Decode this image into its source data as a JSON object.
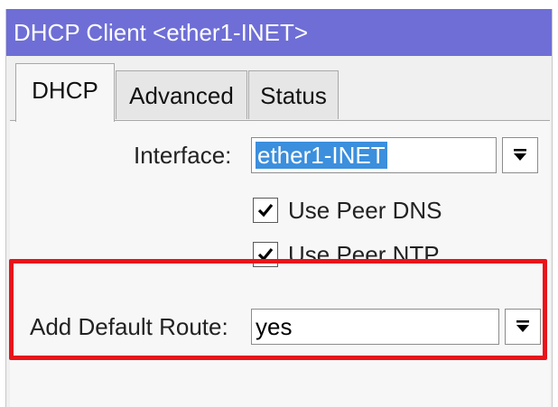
{
  "window": {
    "title": "DHCP Client <ether1-INET>"
  },
  "tabs": [
    {
      "label": "DHCP",
      "active": true
    },
    {
      "label": "Advanced",
      "active": false
    },
    {
      "label": "Status",
      "active": false
    }
  ],
  "form": {
    "interface": {
      "label": "Interface:",
      "value": "ether1-INET"
    },
    "use_peer_dns": {
      "label": "Use Peer DNS",
      "checked": true
    },
    "use_peer_ntp": {
      "label": "Use Peer NTP",
      "checked": true
    },
    "add_default_route": {
      "label": "Add Default Route:",
      "value": "yes"
    }
  },
  "icons": {
    "dropdown": "dropdown-arrow-icon",
    "check": "checkmark-icon"
  },
  "colors": {
    "titlebar": "#6e6ed6",
    "selection": "#3b8fdd",
    "highlight": "#e8141a"
  }
}
